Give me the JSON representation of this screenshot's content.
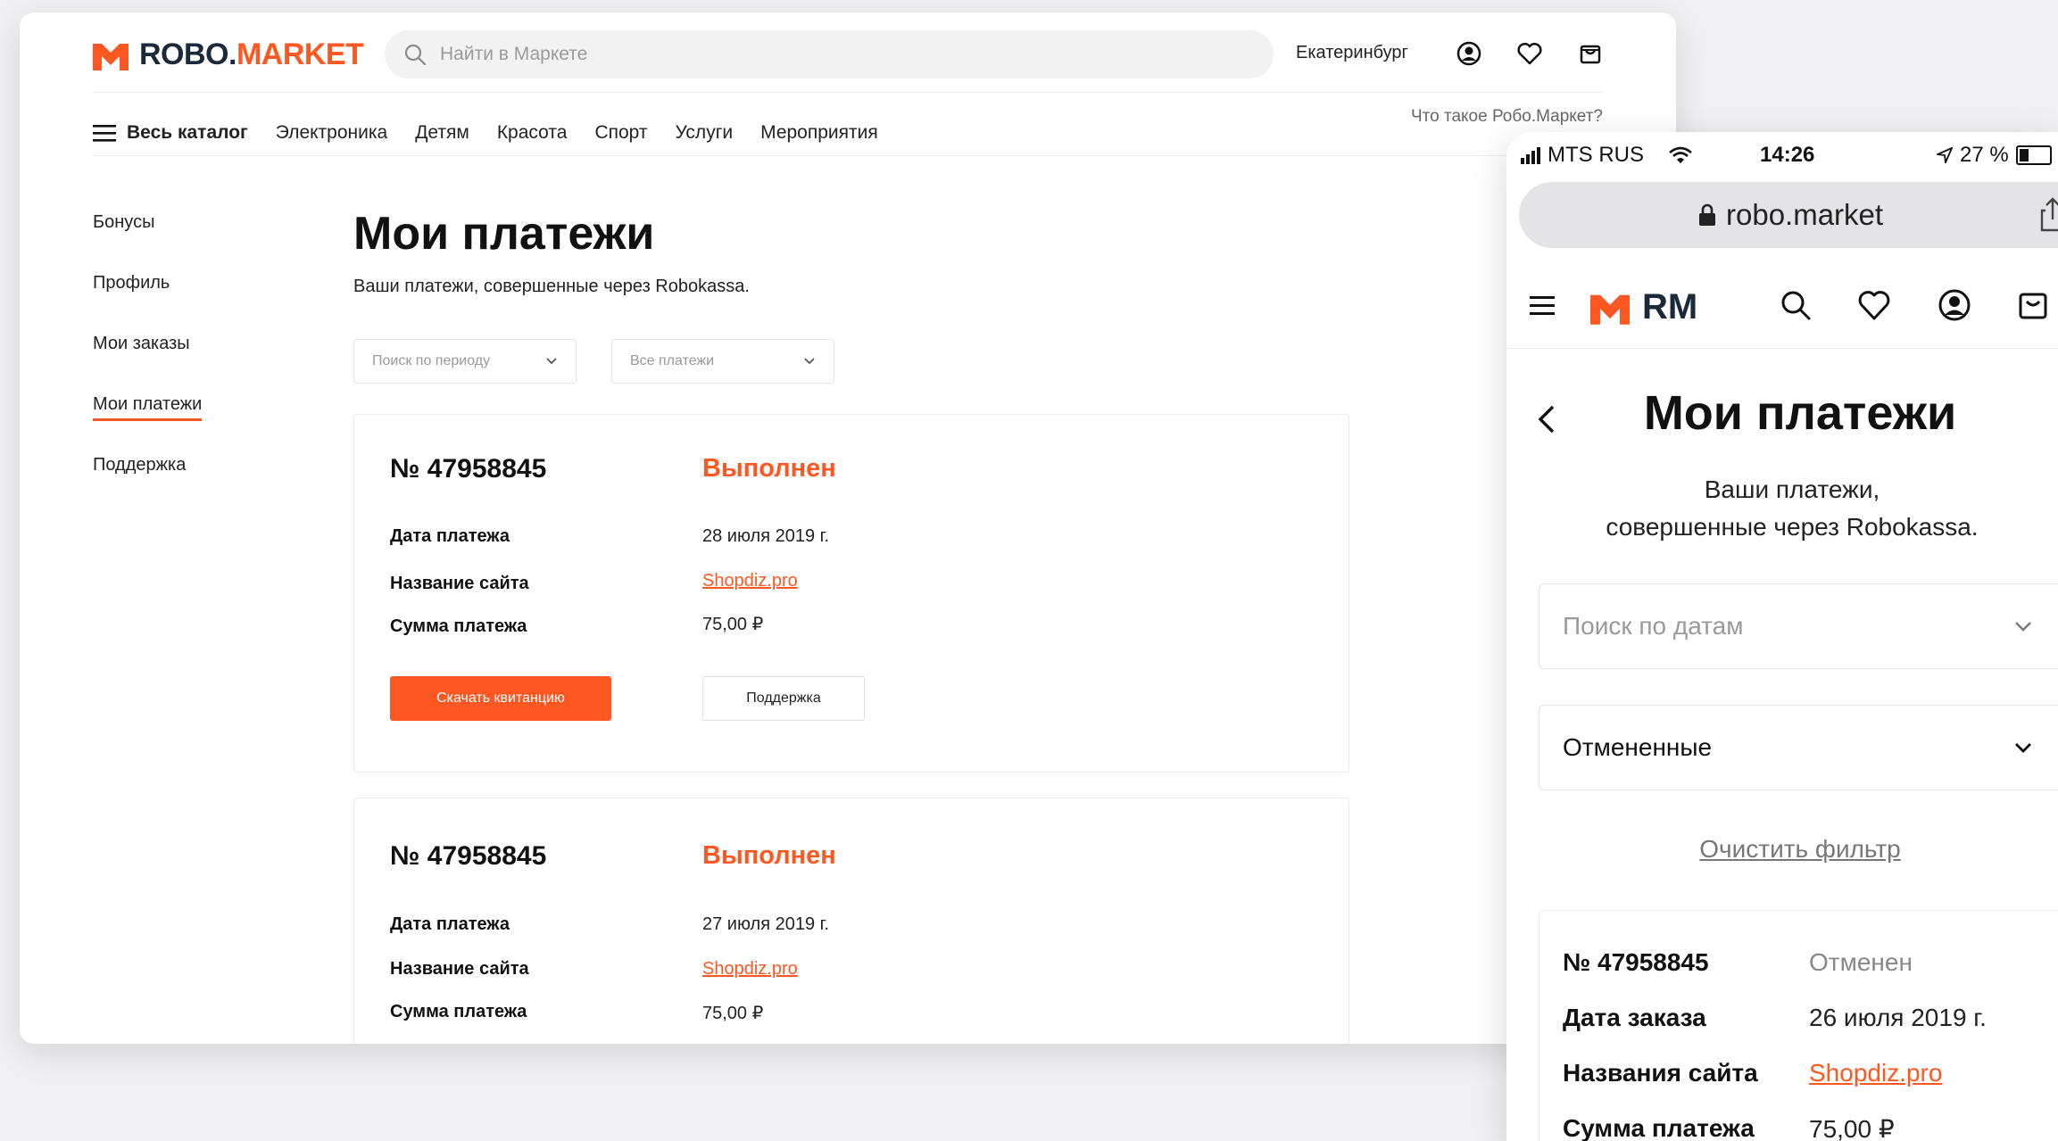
{
  "desktop": {
    "logo": {
      "part1": "ROBO.",
      "part2": "MARKET"
    },
    "search": {
      "placeholder": "Найти в Маркете"
    },
    "city": "Екатеринбург",
    "nav": {
      "catalog": "Весь каталог",
      "items": [
        "Электроника",
        "Детям",
        "Красота",
        "Спорт",
        "Услуги",
        "Мероприятия"
      ],
      "what": "Что такое Робо.Маркет?"
    },
    "sidebar": [
      "Бонусы",
      "Профиль",
      "Мои заказы",
      "Мои платежи",
      "Поддержка"
    ],
    "title": "Мои платежи",
    "subtitle": "Ваши платежи, совершенные через Robokassa.",
    "filters": {
      "period": "Поиск по периоду",
      "type": "Все платежи"
    },
    "labels": {
      "date": "Дата платежа",
      "site": "Название сайта",
      "sum": "Сумма платежа"
    },
    "buttons": {
      "download": "Скачать квитанцию",
      "support": "Поддержка"
    },
    "payments": [
      {
        "number": "№ 47958845",
        "status": "Выполнен",
        "date": "28 июля 2019 г.",
        "site": "Shopdiz.pro",
        "sum": "75,00 ₽"
      },
      {
        "number": "№ 47958845",
        "status": "Выполнен",
        "date": "27 июля 2019 г.",
        "site": "Shopdiz.pro",
        "sum": "75,00 ₽"
      }
    ]
  },
  "mobile": {
    "status_bar": {
      "carrier": "MTS RUS",
      "time": "14:26",
      "battery": "27 %"
    },
    "url": "robo.market",
    "logo": "RM",
    "title": "Мои платежи",
    "subtitle_line1": "Ваши платежи,",
    "subtitle_line2": "совершенные через Robokassa.",
    "filter_date": "Поиск по датам",
    "filter_status": "Отмененные",
    "clear": "Очистить фильтр",
    "card": {
      "number": "№ 47958845",
      "status": "Отменен",
      "date_label": "Дата заказа",
      "date": "26 июля 2019 г.",
      "site_label": "Названия сайта",
      "site": "Shopdiz.pro",
      "sum_label": "Сумма платежа",
      "sum": "75,00 ₽"
    }
  },
  "colors": {
    "accent": "#ff5722",
    "text": "#1a1a1a",
    "logo_dark": "#1b2a3a"
  }
}
